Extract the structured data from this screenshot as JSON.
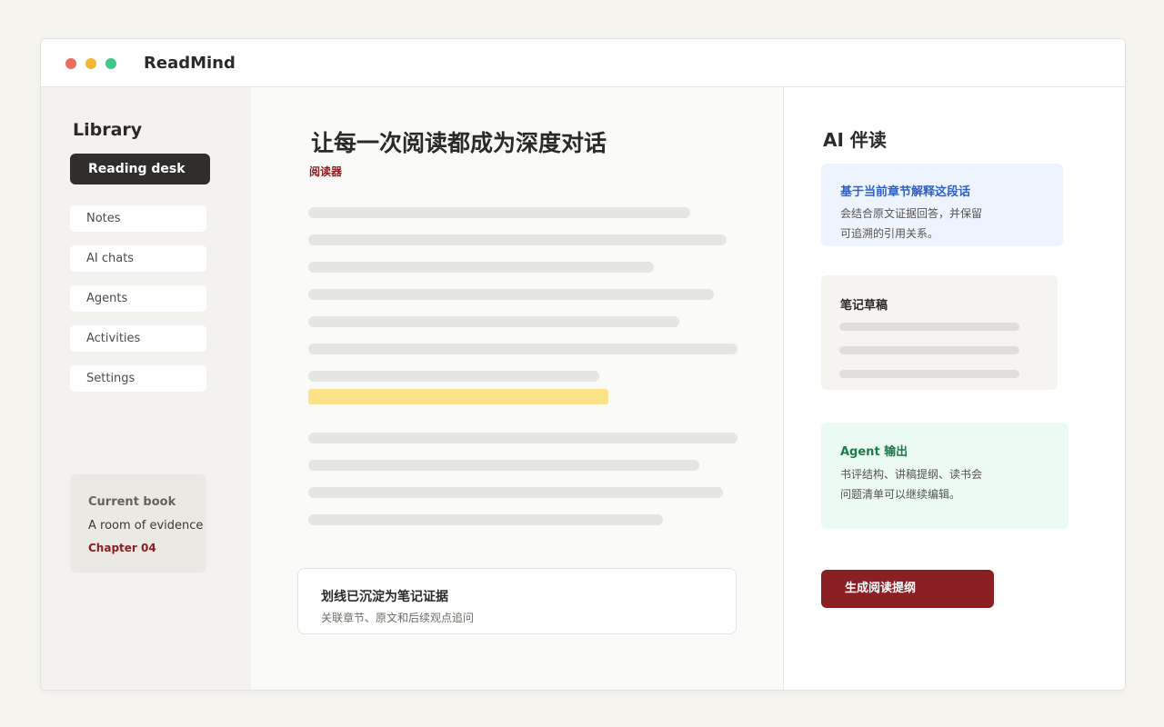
{
  "app": {
    "title": "ReadMind"
  },
  "sidebar": {
    "title": "Library",
    "active_item": "Reading desk",
    "items": [
      {
        "label": "Notes"
      },
      {
        "label": "AI chats"
      },
      {
        "label": "Agents"
      },
      {
        "label": "Activities"
      },
      {
        "label": "Settings"
      }
    ],
    "current_book": {
      "label": "Current book",
      "title": "A room of evidence",
      "chapter": "Chapter 04"
    }
  },
  "reader": {
    "title": "让每一次阅读都成为深度对话",
    "tag": "阅读器",
    "evidence": {
      "title": "划线已沉淀为笔记证据",
      "subtitle": "关联章节、原文和后续观点追问"
    }
  },
  "panel": {
    "title": "AI 伴读",
    "explain_card": {
      "title": "基于当前章节解释这段话",
      "lines": [
        "会结合原文证据回答，并保留",
        "可追溯的引用关系。"
      ]
    },
    "notes_card": {
      "title": "笔记草稿"
    },
    "agent_card": {
      "title": "Agent 输出",
      "lines": [
        "书评结构、讲稿提纲、读书会",
        "问题清单可以继续编辑。"
      ]
    },
    "action_label": "生成阅读提纲"
  },
  "colors": {
    "accent": "#8a2024",
    "highlight": "#fce38a",
    "dark": "#2f2e2c",
    "info_bg": "#eef4fe",
    "success_bg": "#ebfaf3"
  }
}
